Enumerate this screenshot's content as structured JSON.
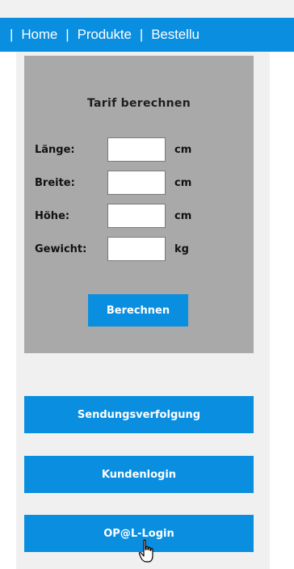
{
  "nav": {
    "separator": "|",
    "items": [
      {
        "label": "Home"
      },
      {
        "label": "Produkte"
      },
      {
        "label": "Bestellu"
      }
    ]
  },
  "tarif": {
    "title": "Tarif berechnen",
    "fields": [
      {
        "label": "Länge:",
        "value": "",
        "unit": "cm"
      },
      {
        "label": "Breite:",
        "value": "",
        "unit": "cm"
      },
      {
        "label": "Höhe:",
        "value": "",
        "unit": "cm"
      },
      {
        "label": "Gewicht:",
        "value": "",
        "unit": "kg"
      }
    ],
    "button_label": "Berechnen"
  },
  "links": {
    "tracking": "Sendungsverfolgung",
    "customer_login": "Kundenlogin",
    "opal_login": "OP@L-Login"
  },
  "colors": {
    "brand_blue": "#0a8ee0",
    "panel_gray": "#a9a9a9",
    "sidebar_bg": "#f0f0f0"
  },
  "cursor": "hand-pointer-icon"
}
